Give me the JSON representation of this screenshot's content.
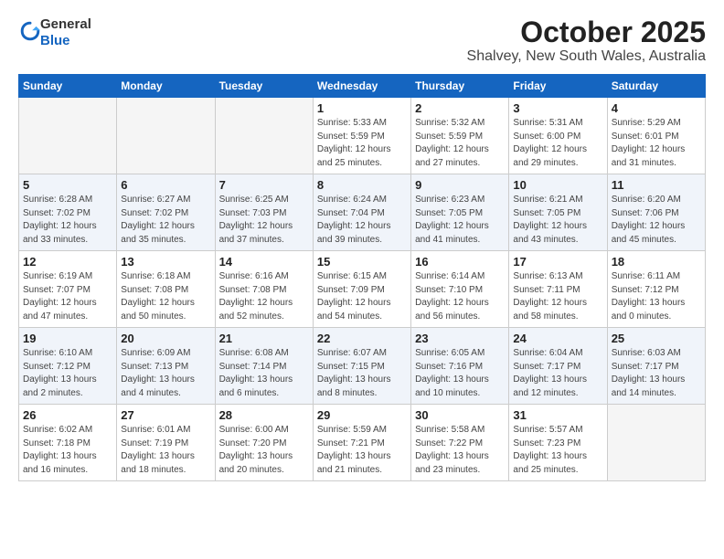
{
  "header": {
    "logo_line1": "General",
    "logo_line2": "Blue",
    "title": "October 2025",
    "subtitle": "Shalvey, New South Wales, Australia"
  },
  "days_of_week": [
    "Sunday",
    "Monday",
    "Tuesday",
    "Wednesday",
    "Thursday",
    "Friday",
    "Saturday"
  ],
  "weeks": [
    [
      {
        "day": "",
        "info": ""
      },
      {
        "day": "",
        "info": ""
      },
      {
        "day": "",
        "info": ""
      },
      {
        "day": "1",
        "info": "Sunrise: 5:33 AM\nSunset: 5:59 PM\nDaylight: 12 hours\nand 25 minutes."
      },
      {
        "day": "2",
        "info": "Sunrise: 5:32 AM\nSunset: 5:59 PM\nDaylight: 12 hours\nand 27 minutes."
      },
      {
        "day": "3",
        "info": "Sunrise: 5:31 AM\nSunset: 6:00 PM\nDaylight: 12 hours\nand 29 minutes."
      },
      {
        "day": "4",
        "info": "Sunrise: 5:29 AM\nSunset: 6:01 PM\nDaylight: 12 hours\nand 31 minutes."
      }
    ],
    [
      {
        "day": "5",
        "info": "Sunrise: 6:28 AM\nSunset: 7:02 PM\nDaylight: 12 hours\nand 33 minutes."
      },
      {
        "day": "6",
        "info": "Sunrise: 6:27 AM\nSunset: 7:02 PM\nDaylight: 12 hours\nand 35 minutes."
      },
      {
        "day": "7",
        "info": "Sunrise: 6:25 AM\nSunset: 7:03 PM\nDaylight: 12 hours\nand 37 minutes."
      },
      {
        "day": "8",
        "info": "Sunrise: 6:24 AM\nSunset: 7:04 PM\nDaylight: 12 hours\nand 39 minutes."
      },
      {
        "day": "9",
        "info": "Sunrise: 6:23 AM\nSunset: 7:05 PM\nDaylight: 12 hours\nand 41 minutes."
      },
      {
        "day": "10",
        "info": "Sunrise: 6:21 AM\nSunset: 7:05 PM\nDaylight: 12 hours\nand 43 minutes."
      },
      {
        "day": "11",
        "info": "Sunrise: 6:20 AM\nSunset: 7:06 PM\nDaylight: 12 hours\nand 45 minutes."
      }
    ],
    [
      {
        "day": "12",
        "info": "Sunrise: 6:19 AM\nSunset: 7:07 PM\nDaylight: 12 hours\nand 47 minutes."
      },
      {
        "day": "13",
        "info": "Sunrise: 6:18 AM\nSunset: 7:08 PM\nDaylight: 12 hours\nand 50 minutes."
      },
      {
        "day": "14",
        "info": "Sunrise: 6:16 AM\nSunset: 7:08 PM\nDaylight: 12 hours\nand 52 minutes."
      },
      {
        "day": "15",
        "info": "Sunrise: 6:15 AM\nSunset: 7:09 PM\nDaylight: 12 hours\nand 54 minutes."
      },
      {
        "day": "16",
        "info": "Sunrise: 6:14 AM\nSunset: 7:10 PM\nDaylight: 12 hours\nand 56 minutes."
      },
      {
        "day": "17",
        "info": "Sunrise: 6:13 AM\nSunset: 7:11 PM\nDaylight: 12 hours\nand 58 minutes."
      },
      {
        "day": "18",
        "info": "Sunrise: 6:11 AM\nSunset: 7:12 PM\nDaylight: 13 hours\nand 0 minutes."
      }
    ],
    [
      {
        "day": "19",
        "info": "Sunrise: 6:10 AM\nSunset: 7:12 PM\nDaylight: 13 hours\nand 2 minutes."
      },
      {
        "day": "20",
        "info": "Sunrise: 6:09 AM\nSunset: 7:13 PM\nDaylight: 13 hours\nand 4 minutes."
      },
      {
        "day": "21",
        "info": "Sunrise: 6:08 AM\nSunset: 7:14 PM\nDaylight: 13 hours\nand 6 minutes."
      },
      {
        "day": "22",
        "info": "Sunrise: 6:07 AM\nSunset: 7:15 PM\nDaylight: 13 hours\nand 8 minutes."
      },
      {
        "day": "23",
        "info": "Sunrise: 6:05 AM\nSunset: 7:16 PM\nDaylight: 13 hours\nand 10 minutes."
      },
      {
        "day": "24",
        "info": "Sunrise: 6:04 AM\nSunset: 7:17 PM\nDaylight: 13 hours\nand 12 minutes."
      },
      {
        "day": "25",
        "info": "Sunrise: 6:03 AM\nSunset: 7:17 PM\nDaylight: 13 hours\nand 14 minutes."
      }
    ],
    [
      {
        "day": "26",
        "info": "Sunrise: 6:02 AM\nSunset: 7:18 PM\nDaylight: 13 hours\nand 16 minutes."
      },
      {
        "day": "27",
        "info": "Sunrise: 6:01 AM\nSunset: 7:19 PM\nDaylight: 13 hours\nand 18 minutes."
      },
      {
        "day": "28",
        "info": "Sunrise: 6:00 AM\nSunset: 7:20 PM\nDaylight: 13 hours\nand 20 minutes."
      },
      {
        "day": "29",
        "info": "Sunrise: 5:59 AM\nSunset: 7:21 PM\nDaylight: 13 hours\nand 21 minutes."
      },
      {
        "day": "30",
        "info": "Sunrise: 5:58 AM\nSunset: 7:22 PM\nDaylight: 13 hours\nand 23 minutes."
      },
      {
        "day": "31",
        "info": "Sunrise: 5:57 AM\nSunset: 7:23 PM\nDaylight: 13 hours\nand 25 minutes."
      },
      {
        "day": "",
        "info": ""
      }
    ]
  ]
}
